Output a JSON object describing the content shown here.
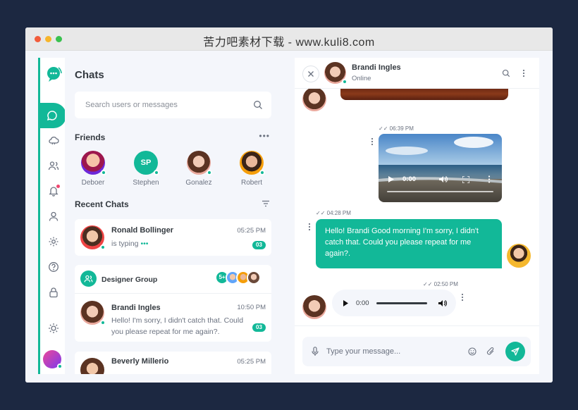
{
  "window": {
    "title": "苦力吧素材下载 - www.kuli8.com"
  },
  "sidebar": {
    "icons": [
      "chat-icon",
      "cloud-icon",
      "users-icon",
      "bell-icon",
      "user-icon",
      "settings-icon",
      "help-icon",
      "lock-icon",
      "sun-icon"
    ]
  },
  "chats": {
    "title": "Chats",
    "search_placeholder": "Search users or messages",
    "friends_title": "Friends",
    "friends": [
      {
        "name": "Deboer"
      },
      {
        "name": "Stephen",
        "initials": "SP"
      },
      {
        "name": "Gonalez"
      },
      {
        "name": "Robert"
      }
    ],
    "recent_title": "Recent Chats",
    "recent": [
      {
        "name": "Ronald Bollinger",
        "time": "05:25 PM",
        "message": "is typing",
        "unread": "03"
      },
      {
        "group": "Designer Group",
        "more": "5+",
        "name": "Brandi Ingles",
        "time": "10:50 PM",
        "message_line1": "Hello! I'm sorry, I didn't catch that. Could",
        "message_line2": "you please repeat for me again?.",
        "unread": "03"
      },
      {
        "name": "Beverly Millerio",
        "time": "05:25 PM"
      }
    ]
  },
  "conversation": {
    "contact_name": "Brandi Ingles",
    "contact_status": "Online",
    "video_time_label": "06:39 PM",
    "video_current": "0:00",
    "text_time_label": "04:28 PM",
    "text_message": "Hello! Brandi Good morning I'm sorry, I didn't catch that. Could you please repeat for me again?.",
    "audio_time_label": "02:50 PM",
    "audio_current": "0:00",
    "input_placeholder": "Type your message..."
  },
  "colors": {
    "accent": "#12b898",
    "background": "#1c2841",
    "panel": "#f4f6fb"
  }
}
